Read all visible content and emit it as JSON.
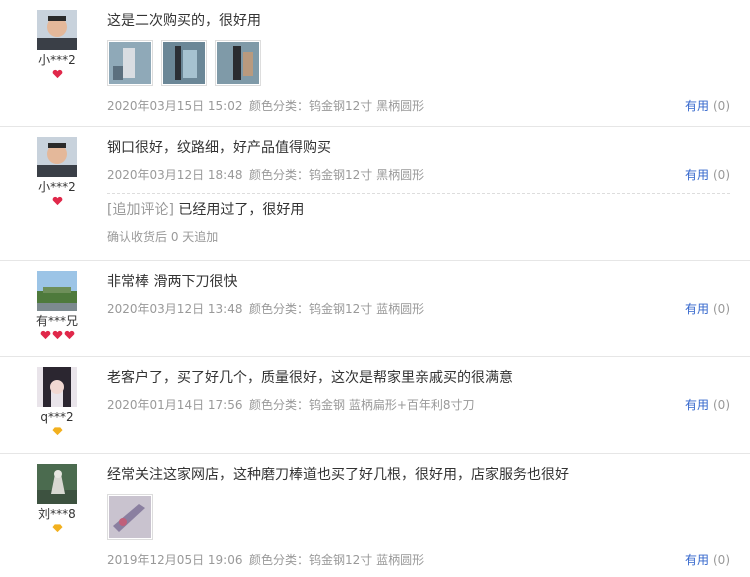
{
  "reviews": [
    {
      "user": "小***2",
      "badge": "heart",
      "text": "这是二次购买的，很好用",
      "date": "2020年03月15日 15:02",
      "sku": "颜色分类：钨金钢12寸 黑柄圆形",
      "useful_label": "有用",
      "useful_count": "(0)"
    },
    {
      "user": "小***2",
      "badge": "heart",
      "text": "钢口很好，纹路细，好产品值得购买",
      "date": "2020年03月12日 18:48",
      "sku": "颜色分类：钨金钢12寸 黑柄圆形",
      "useful_label": "有用",
      "useful_count": "(0)",
      "append_tag": "[追加评论]",
      "append_text": "已经用过了，很好用",
      "append_note": "确认收货后 0 天追加"
    },
    {
      "user": "有***兄",
      "badge": "3 hearts",
      "text": "非常棒 滑两下刀很快",
      "date": "2020年03月12日 13:48",
      "sku": "颜色分类：钨金钢12寸 蓝柄圆形",
      "useful_label": "有用",
      "useful_count": "(0)"
    },
    {
      "user": "q***2",
      "badge": "diamond",
      "text": "老客户了，买了好几个，质量很好，这次是帮家里亲戚买的很满意",
      "date": "2020年01月14日 17:56",
      "sku": "颜色分类：钨金钢 蓝柄扁形+百年利8寸刀",
      "useful_label": "有用",
      "useful_count": "(0)"
    },
    {
      "user": "刘***8",
      "badge": "diamond",
      "text": "经常关注这家网店，这种磨刀棒道也买了好几根，很好用，店家服务也很好",
      "date": "2019年12月05日 19:06",
      "sku": "颜色分类：钨金钢12寸 蓝柄圆形",
      "useful_label": "有用",
      "useful_count": "(0)"
    }
  ],
  "colors": {
    "link": "#3366cc",
    "muted": "#999999",
    "heart": "#e0284a",
    "diamond": "#f2b01e"
  }
}
